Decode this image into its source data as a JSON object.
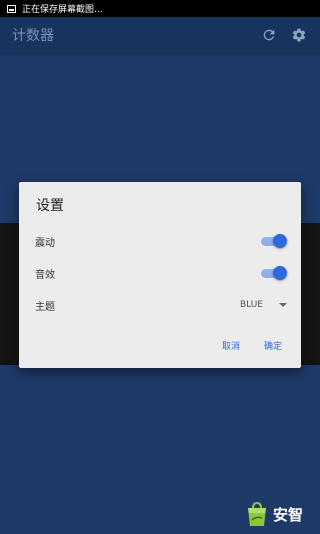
{
  "status_bar": {
    "notification": "正在保存屏幕截图..."
  },
  "app_bar": {
    "title": "计数器"
  },
  "dialog": {
    "title": "设置",
    "rows": [
      {
        "label": "震动",
        "on": true
      },
      {
        "label": "音效",
        "on": true
      },
      {
        "label": "主题",
        "value": "BLUE"
      }
    ],
    "cancel": "取消",
    "confirm": "确定"
  },
  "watermark": {
    "text": "安智"
  },
  "colors": {
    "background": "#1f3a68",
    "app_bar": "#16345d",
    "accent": "#2f68e0",
    "dialog": "#ececec"
  }
}
